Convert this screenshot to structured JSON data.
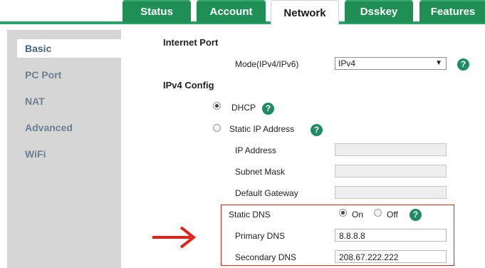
{
  "tabs": [
    {
      "label": "Status"
    },
    {
      "label": "Account"
    },
    {
      "label": "Network"
    },
    {
      "label": "Dsskey"
    },
    {
      "label": "Features"
    }
  ],
  "sidebar": {
    "items": [
      {
        "label": "Basic"
      },
      {
        "label": "PC Port"
      },
      {
        "label": "NAT"
      },
      {
        "label": "Advanced"
      },
      {
        "label": "WiFi"
      }
    ]
  },
  "internet_port": {
    "heading": "Internet Port",
    "mode_label": "Mode(IPv4/IPv6)",
    "mode_value": "IPv4"
  },
  "ipv4": {
    "heading": "IPv4 Config",
    "dhcp_label": "DHCP",
    "static_label": "Static IP Address",
    "ip_address_label": "IP Address",
    "subnet_mask_label": "Subnet Mask",
    "default_gateway_label": "Default Gateway",
    "static_dns_label": "Static DNS",
    "on_label": "On",
    "off_label": "Off",
    "primary_dns_label": "Primary DNS",
    "primary_dns_value": "8.8.8.8",
    "secondary_dns_label": "Secondary DNS",
    "secondary_dns_value": "208.67.222.222"
  },
  "help_glyph": "?",
  "dropdown_glyph": "▼",
  "colors": {
    "tab_green": "#1f8f55",
    "help_green": "#1c8b66",
    "highlight_red": "#e2231a",
    "sidebar_gray": "#d6d6d6"
  }
}
